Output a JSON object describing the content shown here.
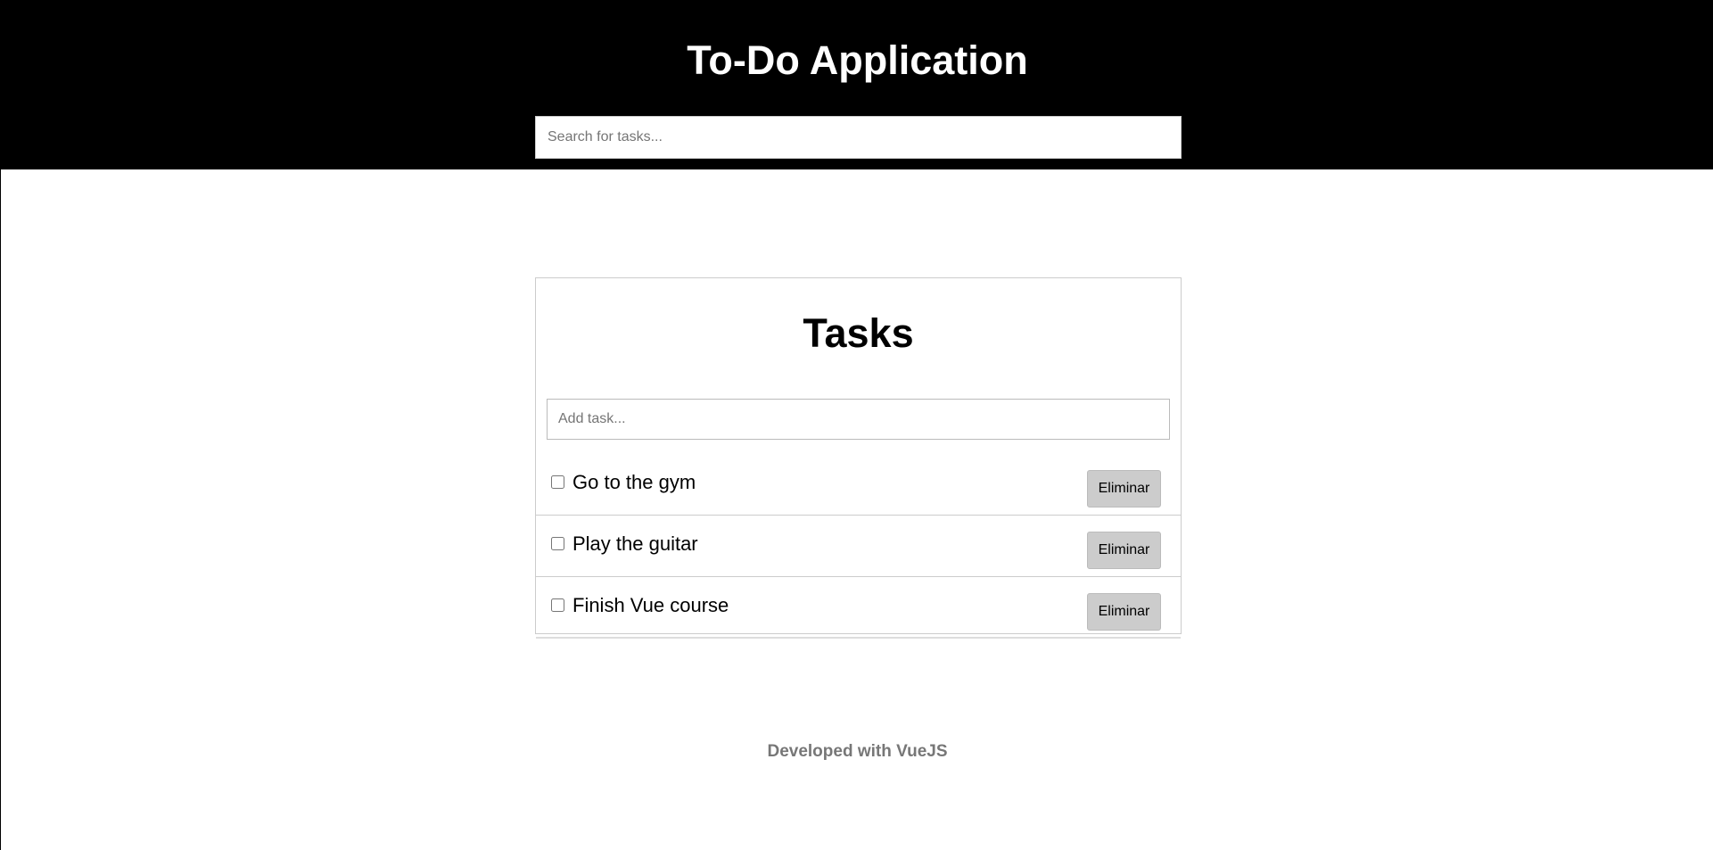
{
  "header": {
    "title": "To-Do Application",
    "search_placeholder": "Search for tasks..."
  },
  "tasks_panel": {
    "title": "Tasks",
    "add_placeholder": "Add task...",
    "items": [
      {
        "label": "Go to the gym",
        "checked": false,
        "delete_label": "Eliminar"
      },
      {
        "label": "Play the guitar",
        "checked": false,
        "delete_label": "Eliminar"
      },
      {
        "label": "Finish Vue course",
        "checked": false,
        "delete_label": "Eliminar"
      }
    ]
  },
  "footer": {
    "text": "Developed with VueJS"
  },
  "colors": {
    "header_bg": "#000000",
    "button_bg": "#cccccc",
    "footer_text": "#777777"
  }
}
